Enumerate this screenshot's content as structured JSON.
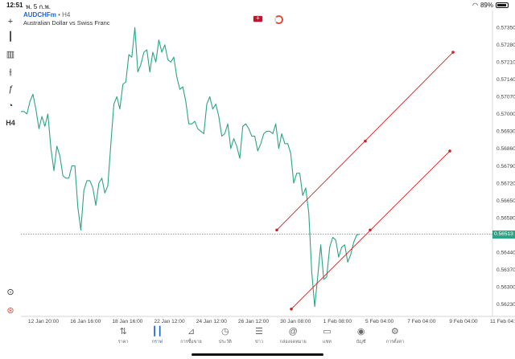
{
  "statusbar": {
    "time": "12:51",
    "date": "พ. 5 ก.พ.",
    "battery": "89%",
    "battery_level": 0.89
  },
  "chart": {
    "symbol": "AUDCHFm",
    "timeframe": "H4",
    "description": "Australian Dollar vs Swiss Franc",
    "current_price": "0.56513",
    "colors": {
      "line": "#2aa584",
      "trend": "#d61f1f",
      "price_line": "#2aa584",
      "accent": "#1a66d6"
    }
  },
  "toolbar": {
    "items": [
      {
        "icon": "crosshair-icon",
        "glyph": "+"
      },
      {
        "icon": "candles-icon",
        "glyph": "┃"
      },
      {
        "icon": "indicators-icon",
        "glyph": "📊"
      },
      {
        "icon": "settings-sliders-icon",
        "glyph": "⫲"
      },
      {
        "icon": "function-icon",
        "glyph": "ƒ"
      },
      {
        "icon": "objects-icon",
        "glyph": "◔"
      },
      {
        "icon": "timeframe-label",
        "glyph": "H4"
      },
      {
        "icon": "zoom-icon",
        "glyph": "⊙"
      },
      {
        "icon": "broker-logo-icon",
        "glyph": "⊛"
      }
    ]
  },
  "nav": {
    "items": [
      {
        "icon": "quotes-icon",
        "glyph": "⇅",
        "label": "ราคา"
      },
      {
        "icon": "chart-icon",
        "glyph": "┃┃",
        "label": "กราฟ",
        "active": true
      },
      {
        "icon": "trade-icon",
        "glyph": "⊿",
        "label": "การซื้อขาย"
      },
      {
        "icon": "history-icon",
        "glyph": "◷",
        "label": "ประวัติ"
      },
      {
        "icon": "news-icon",
        "glyph": "☰",
        "label": "ข่าว"
      },
      {
        "icon": "mailbox-icon",
        "glyph": "@",
        "label": "กล่องจดหมาย"
      },
      {
        "icon": "chat-icon",
        "glyph": "▭",
        "label": "แชท"
      },
      {
        "icon": "account-icon",
        "glyph": "◉",
        "label": "บัญชี"
      },
      {
        "icon": "settings-icon",
        "glyph": "⚙",
        "label": "การตั้งค่า"
      }
    ]
  },
  "chart_data": {
    "type": "line",
    "price_labels": [
      "0.57350",
      "0.57280",
      "0.57210",
      "0.57140",
      "0.57070",
      "0.57000",
      "0.56930",
      "0.56860",
      "0.56790",
      "0.56720",
      "0.56650",
      "0.56580",
      "0.56513",
      "0.56440",
      "0.56370",
      "0.56300",
      "0.56230"
    ],
    "date_labels": [
      "12 Jan 20:00",
      "16 Jan 16:00",
      "18 Jan 16:00",
      "22 Jan 12:00",
      "24 Jan 12:00",
      "26 Jan 12:00",
      "30 Jan 08:00",
      "1 Feb 08:00",
      "5 Feb 04:00",
      "7 Feb 04:00",
      "9 Feb 04:00",
      "11 Feb 04:00"
    ],
    "ylim": [
      0.5618,
      0.5739
    ],
    "prices": [
      0.5701,
      0.5701,
      0.57,
      0.5705,
      0.5708,
      0.5702,
      0.5694,
      0.5699,
      0.5695,
      0.57,
      0.5686,
      0.5677,
      0.5687,
      0.5683,
      0.5675,
      0.5674,
      0.5674,
      0.5679,
      0.5679,
      0.5662,
      0.5653,
      0.5669,
      0.5673,
      0.5673,
      0.567,
      0.5663,
      0.5672,
      0.5674,
      0.5668,
      0.5671,
      0.5688,
      0.5704,
      0.5707,
      0.5702,
      0.5712,
      0.5713,
      0.5724,
      0.5723,
      0.5735,
      0.5717,
      0.572,
      0.5725,
      0.5726,
      0.5717,
      0.5725,
      0.5721,
      0.573,
      0.5725,
      0.5728,
      0.5722,
      0.5721,
      0.5723,
      0.5715,
      0.571,
      0.5711,
      0.5705,
      0.5696,
      0.5696,
      0.5697,
      0.5694,
      0.5693,
      0.5692,
      0.5704,
      0.5707,
      0.5702,
      0.5704,
      0.5699,
      0.5691,
      0.5692,
      0.5696,
      0.5686,
      0.569,
      0.5687,
      0.5682,
      0.5695,
      0.5696,
      0.5694,
      0.5691,
      0.5691,
      0.5685,
      0.5688,
      0.5692,
      0.5693,
      0.5693,
      0.5692,
      0.5696,
      0.5686,
      0.5692,
      0.5688,
      0.5688,
      0.5684,
      0.5672,
      0.5676,
      0.5676,
      0.5667,
      0.567,
      0.566,
      0.5636,
      0.5622,
      0.5634,
      0.5647,
      0.5633,
      0.5634,
      0.5646,
      0.565,
      0.5649,
      0.5642,
      0.5646,
      0.5647,
      0.564,
      0.5643,
      0.5648,
      0.5651,
      0.56513
    ],
    "trendlines": [
      {
        "points": [
          [
            0.5653,
            0.5653
          ],
          [
            0.5689,
            0.5689
          ],
          [
            0.5725,
            0.5725
          ]
        ]
      },
      {
        "points": [
          [
            0.5621,
            0.5621
          ],
          [
            0.5653,
            0.5653
          ],
          [
            0.5685,
            0.5685
          ]
        ]
      }
    ],
    "grid": false
  }
}
